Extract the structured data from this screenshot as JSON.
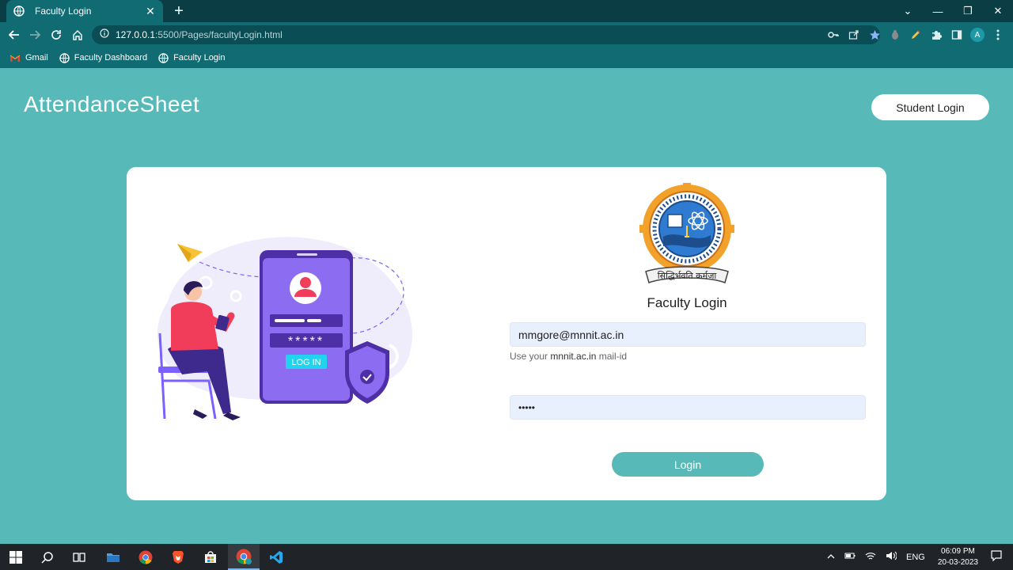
{
  "browser": {
    "tab_title": "Faculty Login",
    "tab_close": "✕",
    "new_tab": "+",
    "url_host": "127.0.0.1",
    "url_rest": ":5500/Pages/facultyLogin.html",
    "avatar_letter": "A",
    "bookmarks": [
      "Gmail",
      "Faculty Dashboard",
      "Faculty Login"
    ],
    "window_controls": [
      "⌄",
      "—",
      "❐",
      "✕"
    ]
  },
  "page": {
    "brand": "AttendanceSheet",
    "student_login": "Student Login",
    "form_title": "Faculty Login",
    "email_value": "mmgore@mnnit.ac.in",
    "hint_prefix": "Use your ",
    "hint_domain": "mnnit.ac.in",
    "hint_suffix": " mail-id",
    "password_mask": "•••••",
    "login_button": "Login",
    "illustration": {
      "password_stars": "*****",
      "login_label": "LOG IN"
    },
    "logo_motto": "सिद्धिर्भवति कर्मजा"
  },
  "taskbar": {
    "language": "ENG",
    "time": "06:09 PM",
    "date": "20-03-2023"
  },
  "colors": {
    "page_bg": "#58b9b9",
    "chrome_tab": "#106b73",
    "chrome_dark": "#0b3d45",
    "field_bg": "#e8effd",
    "accent_purple": "#7b61ff"
  }
}
